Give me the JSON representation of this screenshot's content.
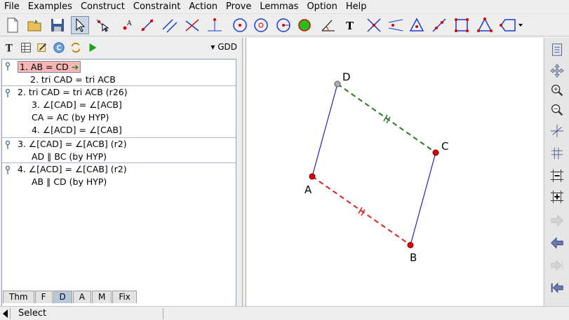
{
  "menu": [
    "File",
    "Examples",
    "Construct",
    "Constraint",
    "Action",
    "Prove",
    "Lemmas",
    "Option",
    "Help"
  ],
  "toolbar": {
    "icons": [
      "new-file-icon",
      "open-file-icon",
      "save-icon",
      "select-arrow-icon",
      "point-tool-icon",
      "text-point-icon",
      "line-icon",
      "parallel-icon",
      "perpendicular-icon",
      "foot-icon",
      "right-angle-icon",
      "circle-icon",
      "circle-three-points-icon",
      "circle-center-icon",
      "polygon-fill-icon",
      "angle-icon",
      "text-icon",
      "intersection-icon",
      "mirror-icon",
      "triangle-icon",
      "measure-icon",
      "square-icon",
      "triangle-red-icon",
      "polygon-icon"
    ]
  },
  "left_panel": {
    "mode_label": "GDD",
    "tree": [
      {
        "lines": [
          {
            "text": "1.  AB = CD",
            "highlight": true
          },
          {
            "text": "2.  tri CAD = tri ACB"
          }
        ]
      },
      {
        "lines": [
          {
            "text": "2.  tri CAD = tri ACB  (r26)"
          },
          {
            "text": "3.  ∠[CAD] = ∠[ACB]"
          },
          {
            "text": "CA = AC   (by HYP)"
          },
          {
            "text": "4.  ∠[ACD] = ∠[CAB]"
          }
        ]
      },
      {
        "lines": [
          {
            "text": "3.  ∠[CAD] = ∠[ACB]  (r2)"
          },
          {
            "text": "AD ∥ BC   (by HYP)"
          }
        ]
      },
      {
        "lines": [
          {
            "text": "4.  ∠[ACD] = ∠[CAB]  (r2)"
          },
          {
            "text": "AB ∥ CD   (by HYP)"
          }
        ]
      }
    ],
    "tabs": [
      "Thm",
      "F",
      "D",
      "A",
      "M",
      "Fix"
    ],
    "active_tab": "D"
  },
  "canvas": {
    "points": [
      {
        "name": "D",
        "color": "#b0b0b0"
      },
      {
        "name": "C",
        "color": "#dd0000"
      },
      {
        "name": "A",
        "color": "#dd0000"
      },
      {
        "name": "B",
        "color": "#dd0000"
      }
    ],
    "segment_colors": {
      "parallel": "#2020c0",
      "equal_dc": "#207a20",
      "equal_ab": "#e02020"
    }
  },
  "right_toolbar": {
    "icons": [
      "scroll-icon",
      "pan-icon",
      "zoom-in-icon",
      "zoom-out-icon",
      "crosshair-icon",
      "grid-icon",
      "grid-minus-icon",
      "grid-plus-icon",
      "forward-arrow-icon",
      "back-arrow-icon",
      "step-forward-icon",
      "step-back-icon"
    ]
  },
  "status": {
    "text": "Select"
  }
}
